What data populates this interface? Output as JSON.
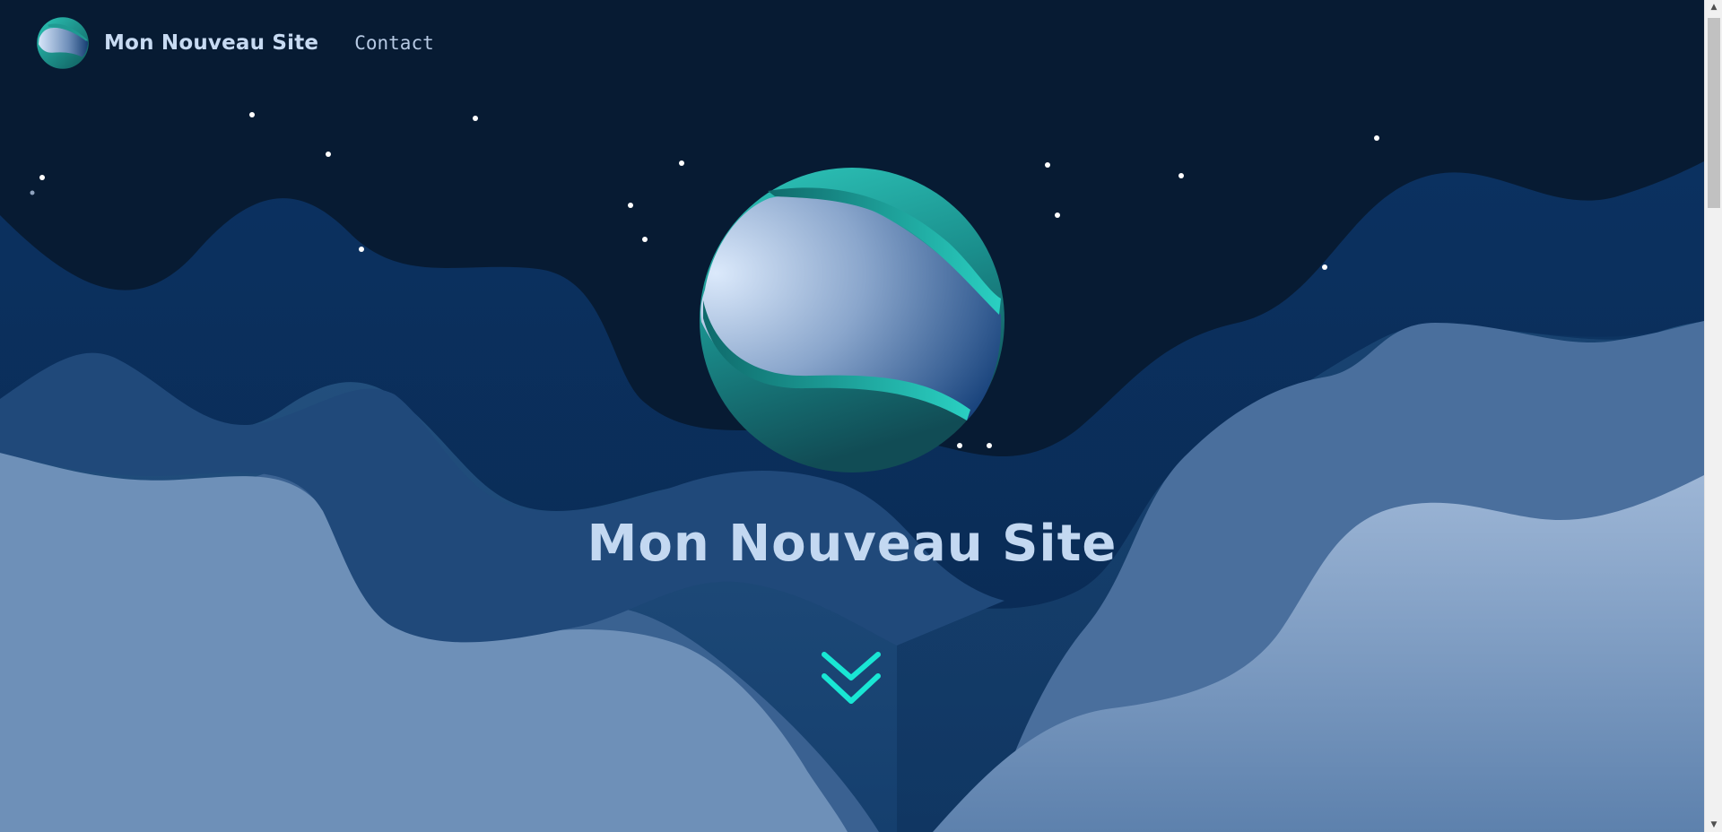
{
  "site": {
    "title": "Mon Nouveau Site"
  },
  "nav": {
    "brand_label": "Mon Nouveau Site",
    "links": [
      {
        "label": "Contact"
      }
    ]
  },
  "hero": {
    "title": "Mon Nouveau Site",
    "scroll_icon": "double-chevron-down-icon"
  },
  "colors": {
    "background": "#071b33",
    "accent": "#19e6d4",
    "title": "#c3d8f1",
    "logo_teal": "#20b5a8",
    "wave_dark": "#0b2e57",
    "wave_mid": "#1f4a7c",
    "wave_light": "#7597bf"
  },
  "scrollbar": {
    "up_icon": "▲",
    "down_icon": "▼"
  }
}
